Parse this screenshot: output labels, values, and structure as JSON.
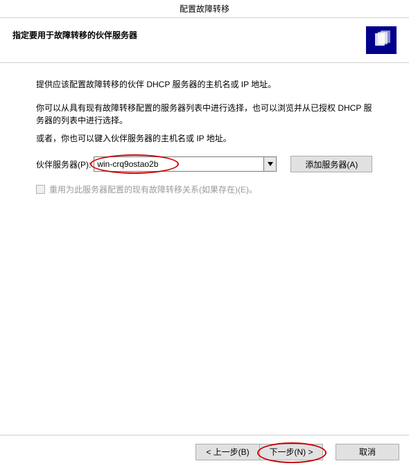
{
  "window": {
    "title": "配置故障转移"
  },
  "header": {
    "heading": "指定要用于故障转移的伙伴服务器"
  },
  "content": {
    "p1": "提供应该配置故障转移的伙伴 DHCP 服务器的主机名或 IP 地址。",
    "p2": "你可以从具有现有故障转移配置的服务器列表中进行选择，也可以浏览并从已授权 DHCP 服务器的列表中进行选择。",
    "p3": "或者，你也可以键入伙伴服务器的主机名或 IP 地址。",
    "partner_label": "伙伴服务器(P):",
    "partner_value": "win-crq9ostao2b",
    "add_server_btn": "添加服务器(A)",
    "reuse_label": "重用为此服务器配置的现有故障转移关系(如果存在)(E)。"
  },
  "footer": {
    "back": "< 上一步(B)",
    "next": "下一步(N) >",
    "cancel": "取消"
  }
}
